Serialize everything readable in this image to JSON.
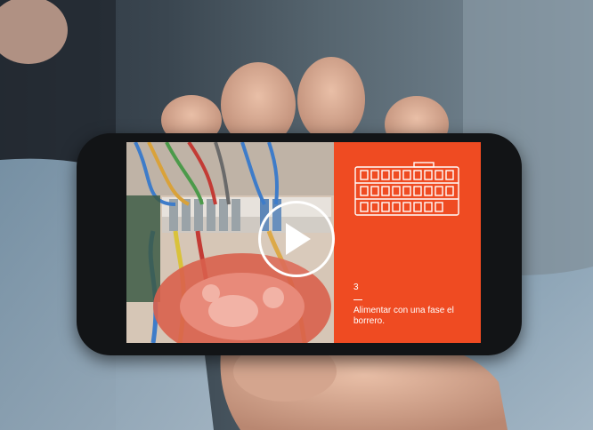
{
  "video_card": {
    "step_number": "3",
    "step_dash": "—",
    "step_text": "Alimentar con una fase el borrero."
  },
  "icons": {
    "play": "play-icon",
    "diagram": "terminal-block-diagram-icon"
  },
  "colors": {
    "accent": "#ef4b22",
    "phone_body": "#121416",
    "icon_stroke": "#ffffff"
  }
}
